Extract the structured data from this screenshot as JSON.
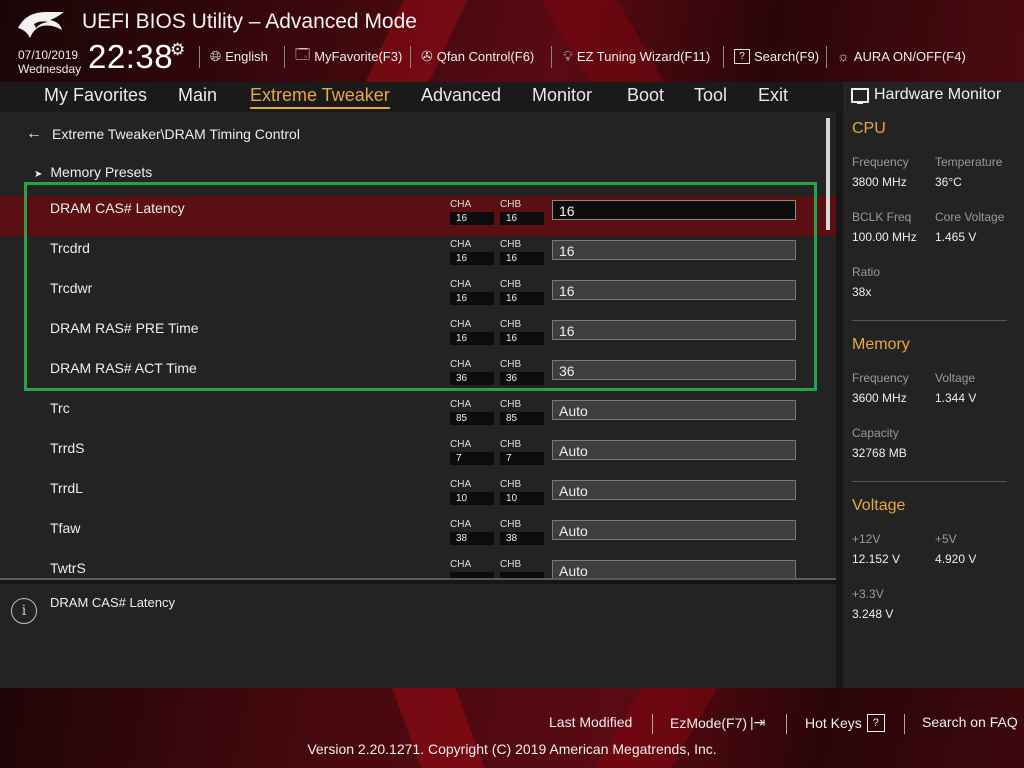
{
  "app": {
    "title": "UEFI BIOS Utility – Advanced Mode"
  },
  "header": {
    "date": "07/10/2019",
    "day": "Wednesday",
    "time": "22:38",
    "tools": {
      "language": "English",
      "favorite": "MyFavorite(F3)",
      "qfan": "Qfan Control(F6)",
      "ez_tuning": "EZ Tuning Wizard(F11)",
      "search": "Search(F9)",
      "aura": "AURA ON/OFF(F4)"
    }
  },
  "menu": {
    "items": [
      "My Favorites",
      "Main",
      "Extreme Tweaker",
      "Advanced",
      "Monitor",
      "Boot",
      "Tool",
      "Exit"
    ],
    "active": "Extreme Tweaker"
  },
  "main": {
    "breadcrumb": "Extreme Tweaker\\DRAM Timing Control",
    "presets": "Memory Presets",
    "channel_a": "CHA",
    "channel_b": "CHB",
    "rows": [
      {
        "label": "DRAM CAS# Latency",
        "cha": "16",
        "chb": "16",
        "value": "16"
      },
      {
        "label": "Trcdrd",
        "cha": "16",
        "chb": "16",
        "value": "16"
      },
      {
        "label": "Trcdwr",
        "cha": "16",
        "chb": "16",
        "value": "16"
      },
      {
        "label": "DRAM RAS# PRE Time",
        "cha": "16",
        "chb": "16",
        "value": "16"
      },
      {
        "label": "DRAM RAS# ACT Time",
        "cha": "36",
        "chb": "36",
        "value": "36"
      },
      {
        "label": "Trc",
        "cha": "85",
        "chb": "85",
        "value": "Auto"
      },
      {
        "label": "TrrdS",
        "cha": "7",
        "chb": "7",
        "value": "Auto"
      },
      {
        "label": "TrrdL",
        "cha": "10",
        "chb": "10",
        "value": "Auto"
      },
      {
        "label": "Tfaw",
        "cha": "38",
        "chb": "38",
        "value": "Auto"
      },
      {
        "label": "TwtrS",
        "cha": "",
        "chb": "",
        "value": "Auto"
      }
    ]
  },
  "help": {
    "text": "DRAM CAS# Latency"
  },
  "hardware_monitor": {
    "title": "Hardware Monitor",
    "cpu": {
      "heading": "CPU",
      "frequency_label": "Frequency",
      "frequency": "3800 MHz",
      "temperature_label": "Temperature",
      "temperature": "36°C",
      "bclk_label": "BCLK Freq",
      "bclk": "100.00 MHz",
      "core_voltage_label": "Core Voltage",
      "core_voltage": "1.465 V",
      "ratio_label": "Ratio",
      "ratio": "38x"
    },
    "memory": {
      "heading": "Memory",
      "frequency_label": "Frequency",
      "frequency": "3600 MHz",
      "voltage_label": "Voltage",
      "voltage": "1.344 V",
      "capacity_label": "Capacity",
      "capacity": "32768 MB"
    },
    "voltage": {
      "heading": "Voltage",
      "v12_label": "+12V",
      "v12": "12.152 V",
      "v5_label": "+5V",
      "v5": "4.920 V",
      "v33_label": "+3.3V",
      "v33": "3.248 V"
    }
  },
  "footer": {
    "last_modified": "Last Modified",
    "ezmode": "EzMode(F7)",
    "hotkeys": "Hot Keys",
    "hotkeys_key": "?",
    "faq": "Search on FAQ",
    "copyright": "Version 2.20.1271. Copyright (C) 2019 American Megatrends, Inc."
  },
  "colors": {
    "accent": "#e9a73b",
    "highlight_box": "#25a147",
    "selected_row": "#5a0f12"
  }
}
